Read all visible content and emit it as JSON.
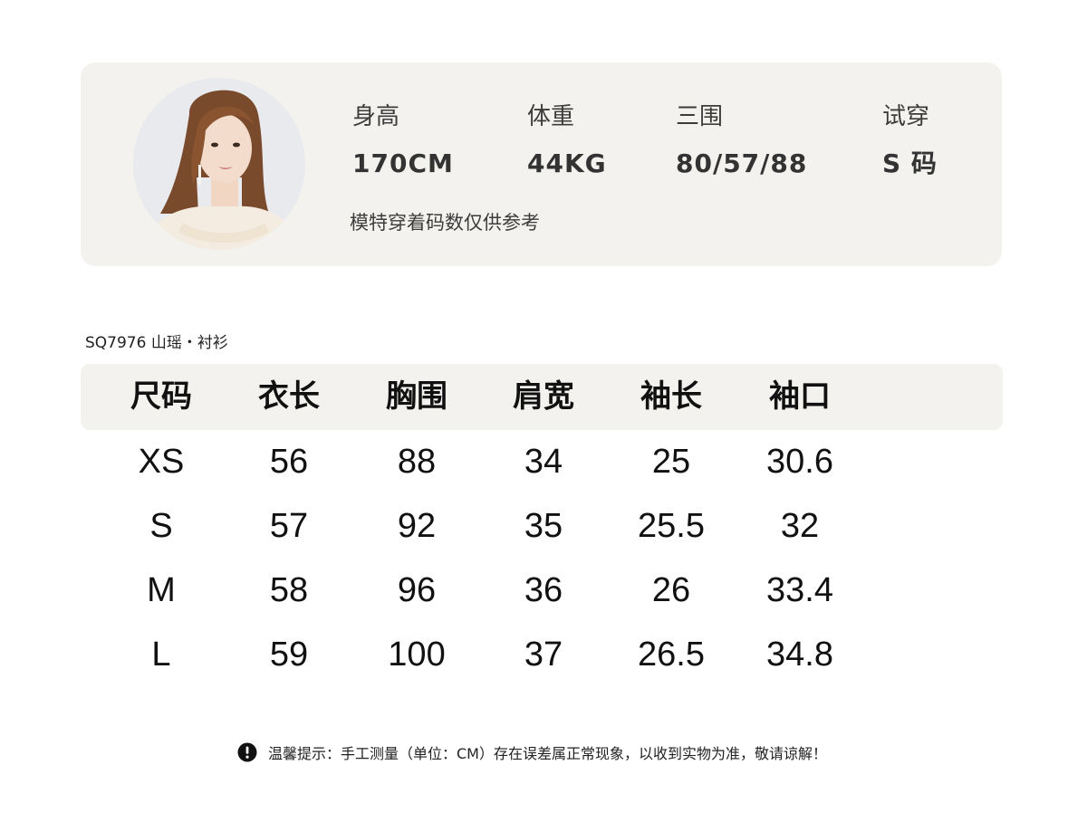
{
  "model": {
    "avatar_icon": "model-portrait",
    "stats": {
      "height_label": "身高",
      "height_value": "170CM",
      "weight_label": "体重",
      "weight_value": "44KG",
      "bwh_label": "三围",
      "bwh_value": "80/57/88",
      "tryon_label": "试穿",
      "tryon_value": "S 码"
    },
    "note": "模特穿着码数仅供参考"
  },
  "product": {
    "title": "SQ7976  山瑶・衬衫"
  },
  "size_table": {
    "headers": [
      "尺码",
      "衣长",
      "胸围",
      "肩宽",
      "袖长",
      "袖口"
    ],
    "rows": [
      [
        "XS",
        "56",
        "88",
        "34",
        "25",
        "30.6"
      ],
      [
        "S",
        "57",
        "92",
        "35",
        "25.5",
        "32"
      ],
      [
        "M",
        "58",
        "96",
        "36",
        "26",
        "33.4"
      ],
      [
        "L",
        "59",
        "100",
        "37",
        "26.5",
        "34.8"
      ]
    ]
  },
  "notice": {
    "icon": "exclamation-circle-icon",
    "text": "温馨提示：手工测量（单位：CM）存在误差属正常现象，以收到实物为准，敬请谅解！"
  },
  "colors": {
    "panel_bg": "#f3f2ee",
    "text": "#111111",
    "muted_text": "#3c3c3c"
  }
}
